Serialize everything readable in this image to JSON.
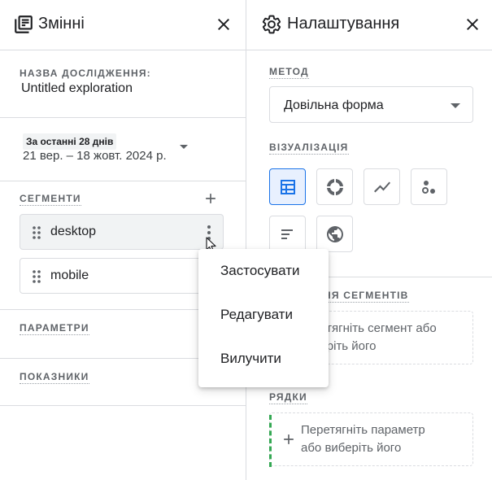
{
  "variables_panel": {
    "title": "Змінні",
    "icon": "variables-icon",
    "close_icon": "close-icon",
    "exploration_name_caption": "НАЗВА ДОСЛІДЖЕННЯ:",
    "exploration_name": "Untitled exploration",
    "date": {
      "chip": "За останні 28 днів",
      "range": "21 вер. – 18 жовт. 2024 р."
    },
    "segments": {
      "caption": "СЕГМЕНТИ",
      "items": [
        {
          "label": "desktop"
        },
        {
          "label": "mobile"
        }
      ]
    },
    "parameters_caption": "ПАРАМЕТРИ",
    "metrics_caption": "ПОКАЗНИКИ"
  },
  "context_menu": {
    "items": [
      "Застосувати",
      "Редагувати",
      "Вилучити"
    ]
  },
  "settings_panel": {
    "title": "Налаштування",
    "icon": "gear-icon",
    "close_icon": "close-icon",
    "method_caption": "МЕТОД",
    "method_value": "Довільна форма",
    "visualization_caption": "ВІЗУАЛІЗАЦІЯ",
    "visualizations": [
      {
        "icon": "table-icon",
        "selected": true
      },
      {
        "icon": "donut-chart-icon",
        "selected": false
      },
      {
        "icon": "line-chart-icon",
        "selected": false
      },
      {
        "icon": "scatter-plot-icon",
        "selected": false
      },
      {
        "icon": "bar-chart-icon",
        "selected": false
      },
      {
        "icon": "geo-map-icon",
        "selected": false
      }
    ],
    "segment_comparisons_caption_partial": "НЯ СЕГМЕНТІВ",
    "segment_drop_text_line1": "ретягніть сегмент або",
    "segment_drop_text_line2": "беріть його",
    "rows_caption": "РЯДКИ",
    "rows_drop_text_line1": "Перетягніть параметр",
    "rows_drop_text_line2": "або виберіть його"
  },
  "colors": {
    "accent": "#1a73e8",
    "accent_bg": "#e8f0fe",
    "border": "#dadce0",
    "text": "#202124",
    "muted": "#5f6368",
    "drop_indicator": "#34a853"
  }
}
